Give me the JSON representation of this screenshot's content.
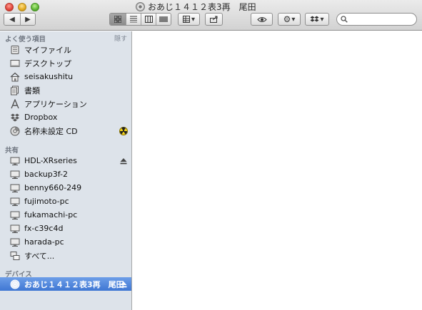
{
  "window": {
    "title": "おあじ１４１２表3再　尾田"
  },
  "toolbar": {
    "back_symbol": "◀",
    "forward_symbol": "▶",
    "arrange_symbol": "▾",
    "action_symbol": "▾",
    "dropbox_symbol": "▾",
    "search_placeholder": "",
    "search_value": ""
  },
  "sidebar": {
    "favorites": {
      "header": "よく使う項目",
      "hide": "隠す",
      "items": [
        {
          "label": "マイファイル",
          "icon": "all-my-files-icon"
        },
        {
          "label": "デスクトップ",
          "icon": "desktop-icon"
        },
        {
          "label": "seisakushitu",
          "icon": "home-icon"
        },
        {
          "label": "書類",
          "icon": "documents-icon"
        },
        {
          "label": "アプリケーション",
          "icon": "applications-icon"
        },
        {
          "label": "Dropbox",
          "icon": "dropbox-icon"
        },
        {
          "label": "名称未設定 CD",
          "icon": "cd-icon",
          "badge": "burn-icon"
        }
      ]
    },
    "shared": {
      "header": "共有",
      "items": [
        {
          "label": "HDL-XRseries",
          "icon": "server-icon",
          "eject": true
        },
        {
          "label": "backup3f-2",
          "icon": "computer-icon"
        },
        {
          "label": "benny660-249",
          "icon": "computer-icon"
        },
        {
          "label": "fujimoto-pc",
          "icon": "computer-icon"
        },
        {
          "label": "fukamachi-pc",
          "icon": "computer-icon"
        },
        {
          "label": "fx-c39c4d",
          "icon": "computer-icon"
        },
        {
          "label": "harada-pc",
          "icon": "computer-icon"
        },
        {
          "label": "すべて...",
          "icon": "network-icon"
        }
      ]
    },
    "devices": {
      "header": "デバイス",
      "items": [
        {
          "label": "おあじ１４１２表3再　尾田",
          "icon": "disc-icon",
          "eject": true,
          "selected": true
        }
      ]
    }
  },
  "colors": {
    "sidebar_bg": "#dde3ea",
    "selection": "#3f77d3",
    "section_header": "#6f7680"
  }
}
